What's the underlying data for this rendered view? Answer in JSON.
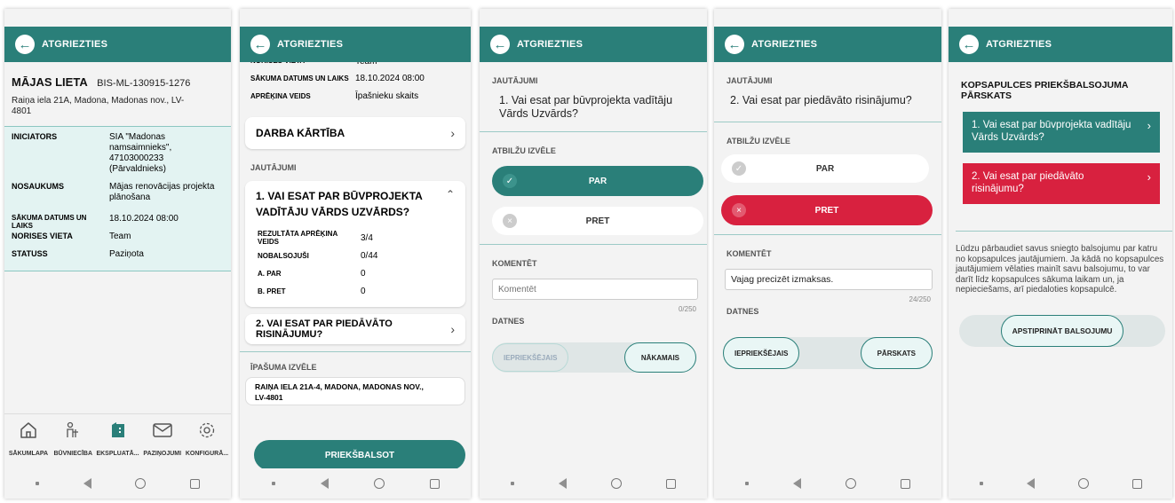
{
  "header": {
    "back_label": "ATGRIEZTIES"
  },
  "screen1": {
    "title": "MĀJAS LIETA",
    "case_id": "BIS-ML-130915-1276",
    "address": "Raiņa iela 21A, Madona, Madonas nov., LV-4801",
    "rows": [
      {
        "label": "INICIATORS",
        "value": "SIA \"Madonas namsaimnieks\", 47103000233 (Pārvaldnieks)"
      },
      {
        "label": "NOSAUKUMS",
        "value": "Mājas renovācijas projekta plānošana"
      },
      {
        "label": "SĀKUMA DATUMS UN LAIKS",
        "value": "18.10.2024 08:00"
      },
      {
        "label": "NORISES VIETA",
        "value": "Team"
      },
      {
        "label": "STATUSS",
        "value": "Paziņota"
      }
    ],
    "tabs": [
      {
        "label": "SĀKUMLAPA",
        "icon": "home-icon"
      },
      {
        "label": "BŪVNIECĪBA",
        "icon": "worker-icon"
      },
      {
        "label": "EKSPLUATĀ...",
        "icon": "building-icon"
      },
      {
        "label": "PAZIŅOJUMI",
        "icon": "mail-icon"
      },
      {
        "label": "KONFIGURĀ...",
        "icon": "gear-icon"
      }
    ]
  },
  "screen2": {
    "top_rows": [
      {
        "label": "NORISES VIETA",
        "value": "Team"
      },
      {
        "label": "SĀKUMA DATUMS UN LAIKS",
        "value": "18.10.2024 08:00"
      },
      {
        "label": "APRĒĶINA VEIDS",
        "value": "Īpašnieku skaits"
      }
    ],
    "agenda_label": "DARBA KĀRTĪBA",
    "questions_heading": "JAUTĀJUMI",
    "question1_title": "1. VAI ESAT PAR BŪVPROJEKTA VADĪTĀJU VĀRDS UZVĀRDS?",
    "q1_rows": [
      {
        "label": "REZULTĀTA APRĒĶINA VEIDS",
        "value": "3/4"
      },
      {
        "label": "NOBALSOJUŠI",
        "value": "0/44"
      },
      {
        "label": "A. PAR",
        "value": "0"
      },
      {
        "label": "B. PRET",
        "value": "0"
      }
    ],
    "question2_title": "2. VAI ESAT PAR PIEDĀVĀTO RISINĀJUMU?",
    "property_heading": "ĪPAŠUMA IZVĒLE",
    "property_value": "RAIŅA IELA 21A-4, MADONA, MADONAS NOV., LV-4801",
    "prevote_button": "PRIEKŠBALSOT"
  },
  "screen3": {
    "questions_heading": "JAUTĀJUMI",
    "question": "1. Vai esat par būvprojekta vadītāju Vārds Uzvārds?",
    "answers_heading": "ATBILŽU IZVĒLE",
    "option_for": "PAR",
    "option_against": "PRET",
    "comment_heading": "KOMENTĒT",
    "comment_placeholder": "Komentēt",
    "comment_counter": "0/250",
    "files_heading": "DATNES",
    "prev_button": "IEPRIEKŠĒJAIS",
    "next_button": "NĀKAMAIS"
  },
  "screen4": {
    "questions_heading": "JAUTĀJUMI",
    "question": "2. Vai esat par piedāvāto risinājumu?",
    "answers_heading": "ATBILŽU IZVĒLE",
    "option_for": "PAR",
    "option_against": "PRET",
    "comment_heading": "KOMENTĒT",
    "comment_value": "Vajag precizēt izmaksas.",
    "comment_counter": "24/250",
    "files_heading": "DATNES",
    "prev_button": "IEPRIEKŠĒJAIS",
    "review_button": "PĀRSKATS"
  },
  "screen5": {
    "title": "KOPSAPULCES PRIEKŠBALSOJUMA PĀRSKATS",
    "item1": "1. Vai esat par būvprojekta vadītāju Vārds Uzvārds?",
    "item2": "2. Vai esat par piedāvāto risinājumu?",
    "note": "Lūdzu pārbaudiet savus sniegto balsojumu par katru no kopsapulces jautājumiem. Ja kādā no kopsapulces jautājumiem vēlaties mainīt savu balsojumu, to var darīt līdz kopsapulces sākuma laikam un, ja nepieciešams, arī piedaloties kopsapulcē.",
    "confirm_button": "APSTIPRINĀT BALSOJUMU"
  },
  "colors": {
    "teal": "#2a7f79",
    "red": "#d8213f",
    "light_teal": "#e3f3f2"
  }
}
